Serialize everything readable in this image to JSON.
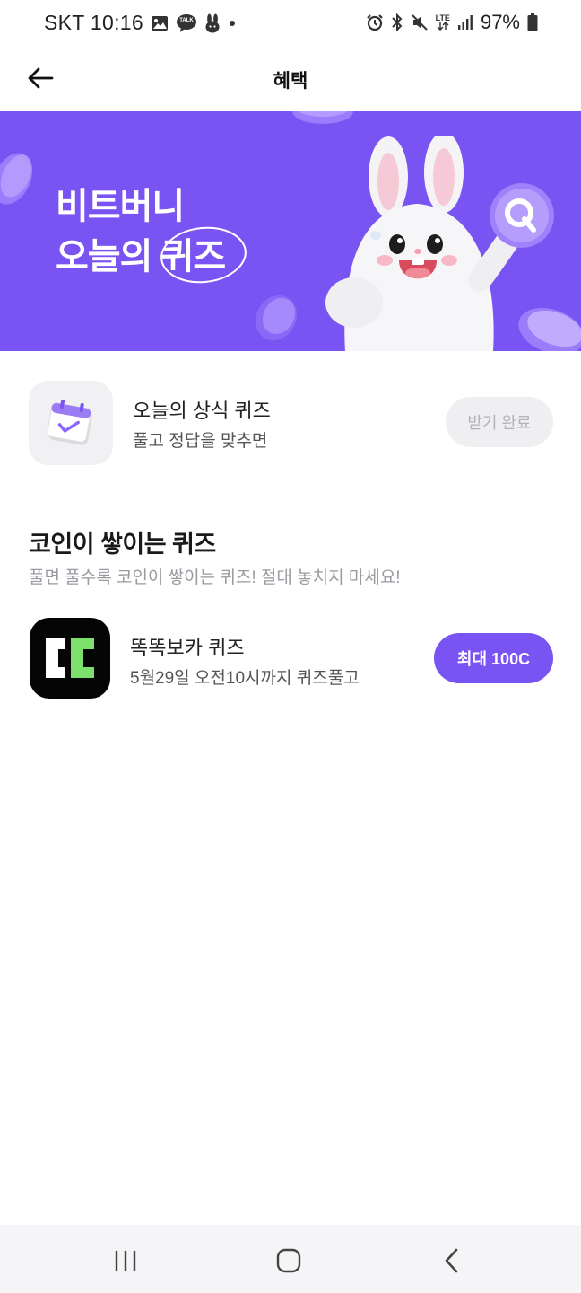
{
  "status_bar": {
    "carrier_time": "SKT 10:16",
    "talk_badge": "TALK",
    "network": "LTE",
    "battery": "97%"
  },
  "header": {
    "title": "혜택",
    "back_icon": "arrow-left-icon"
  },
  "banner": {
    "line1": "비트버니",
    "line2": "오늘의 퀴즈",
    "badge_letter": "Q",
    "accent": "#7a53f3"
  },
  "daily_quiz": {
    "title": "오늘의 상식 퀴즈",
    "subtitle": "풀고 정답을 맞추면",
    "button_label": "받기 완료",
    "icon": "calendar-check-icon"
  },
  "coin_section": {
    "title": "코인이 쌓이는 퀴즈",
    "subtitle": "풀면 풀수록 코인이 쌓이는 퀴즈! 절대 놓치지 마세요!",
    "items": [
      {
        "name": "똑똑보카 퀴즈",
        "deadline": "5월29일 오전10시까지 퀴즈풀고",
        "button_label": "최대 100C",
        "icon": "ttokttok-boca-logo-icon"
      }
    ]
  },
  "colors": {
    "accent": "#7a53f3",
    "logo_green": "#7de06d",
    "disabled_bg": "#efeff2",
    "disabled_text": "#b3b3b8"
  }
}
